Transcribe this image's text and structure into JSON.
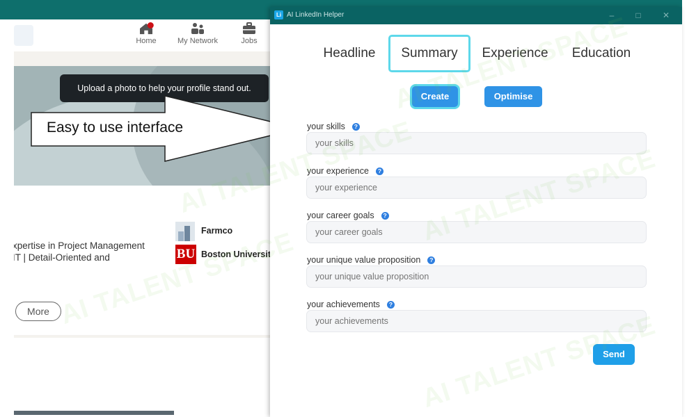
{
  "background_app": {
    "nav": {
      "home": "Home",
      "network": "My Network",
      "jobs": "Jobs"
    },
    "tooltip": "Upload a photo to help your profile stand out.",
    "profile": {
      "name_fragment": "ı",
      "headline_line1": "xpertise in Project Management",
      "headline_line2": "IT | Detail-Oriented and",
      "org1": "Farmco",
      "org2": "Boston University",
      "org2_logo": "BU",
      "more_button": "More"
    }
  },
  "callout": {
    "text": "Easy to use interface"
  },
  "helper": {
    "window_title": "AI LinkedIn Helper",
    "app_icon": "Li",
    "tabs": [
      "Headline",
      "Summary",
      "Experience",
      "Education"
    ],
    "active_tab": "Summary",
    "buttons": {
      "create": "Create",
      "optimise": "Optimise",
      "send": "Send"
    },
    "fields": [
      {
        "label": "your skills",
        "placeholder": "your skills"
      },
      {
        "label": "your experience",
        "placeholder": "your experience"
      },
      {
        "label": "your career goals",
        "placeholder": "your career goals"
      },
      {
        "label": "your unique value proposition",
        "placeholder": "your unique value proposition"
      },
      {
        "label": "your achievements",
        "placeholder": "your achievements"
      }
    ],
    "help_glyph": "?"
  },
  "watermark": "AI TALENT SPACE",
  "colors": {
    "titlebar": "#0a6363",
    "accent_blue": "#2f93e6",
    "active_outline": "#5dd8ea"
  }
}
